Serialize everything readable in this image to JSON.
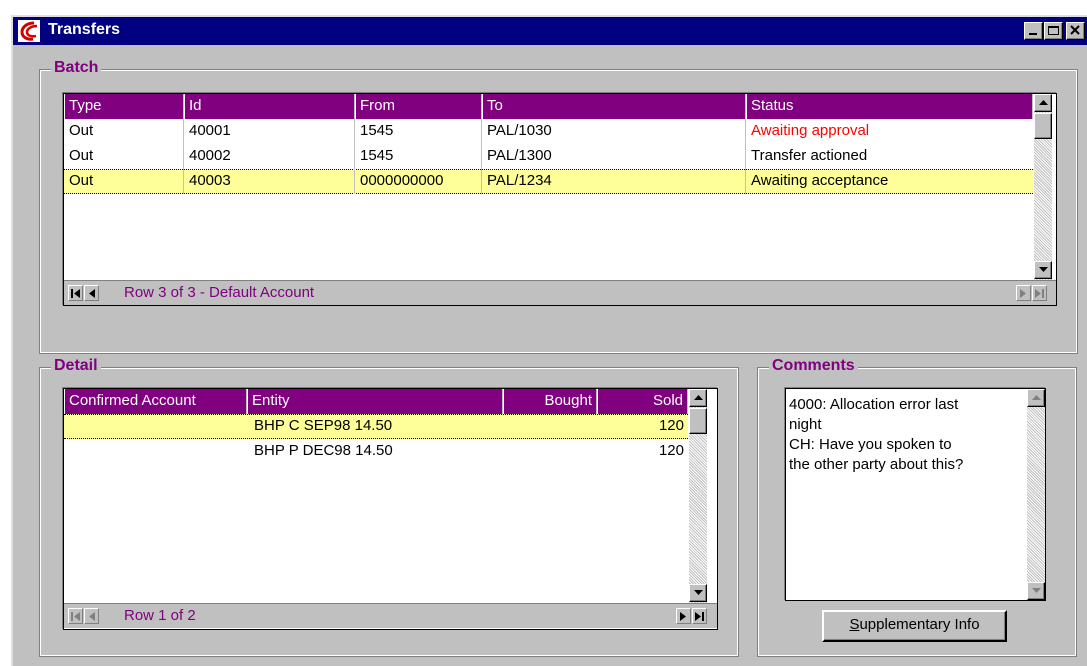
{
  "window": {
    "title": "Transfers"
  },
  "batch": {
    "group_label": "Batch",
    "columns": [
      "Type",
      "Id",
      "From",
      "To",
      "Status"
    ],
    "rows": [
      {
        "type": "Out",
        "id": "40001",
        "from": "1545",
        "to": "PAL/1030",
        "status": "Awaiting approval",
        "status_color": "#ff0000",
        "selected": false
      },
      {
        "type": "Out",
        "id": "40002",
        "from": "1545",
        "to": "PAL/1300",
        "status": "Transfer actioned",
        "status_color": "#000000",
        "selected": false
      },
      {
        "type": "Out",
        "id": "40003",
        "from": "0000000000",
        "to": "PAL/1234",
        "status": "Awaiting acceptance",
        "status_color": "#000000",
        "selected": true
      }
    ],
    "nav_text": "Row 3 of 3 - Default Account"
  },
  "detail": {
    "group_label": "Detail",
    "columns": [
      "Confirmed Account",
      "Entity",
      "Bought",
      "Sold"
    ],
    "rows": [
      {
        "confirmed_account": "",
        "entity": "BHP C SEP98 14.50",
        "bought": "",
        "sold": "120",
        "selected": true
      },
      {
        "confirmed_account": "",
        "entity": "BHP P DEC98 14.50",
        "bought": "",
        "sold": "120",
        "selected": false
      }
    ],
    "nav_text": "Row 1 of 2"
  },
  "comments": {
    "group_label": "Comments",
    "text_lines": [
      "4000: Allocation error last",
      "night",
      "CH: Have you spoken to",
      "the other party about this?"
    ],
    "button_accel": "S",
    "button_rest": "upplementary Info"
  },
  "colors": {
    "header": "#800080",
    "selection": "#ffff99",
    "titlebar": "#000080",
    "accent_text": "#800080"
  }
}
